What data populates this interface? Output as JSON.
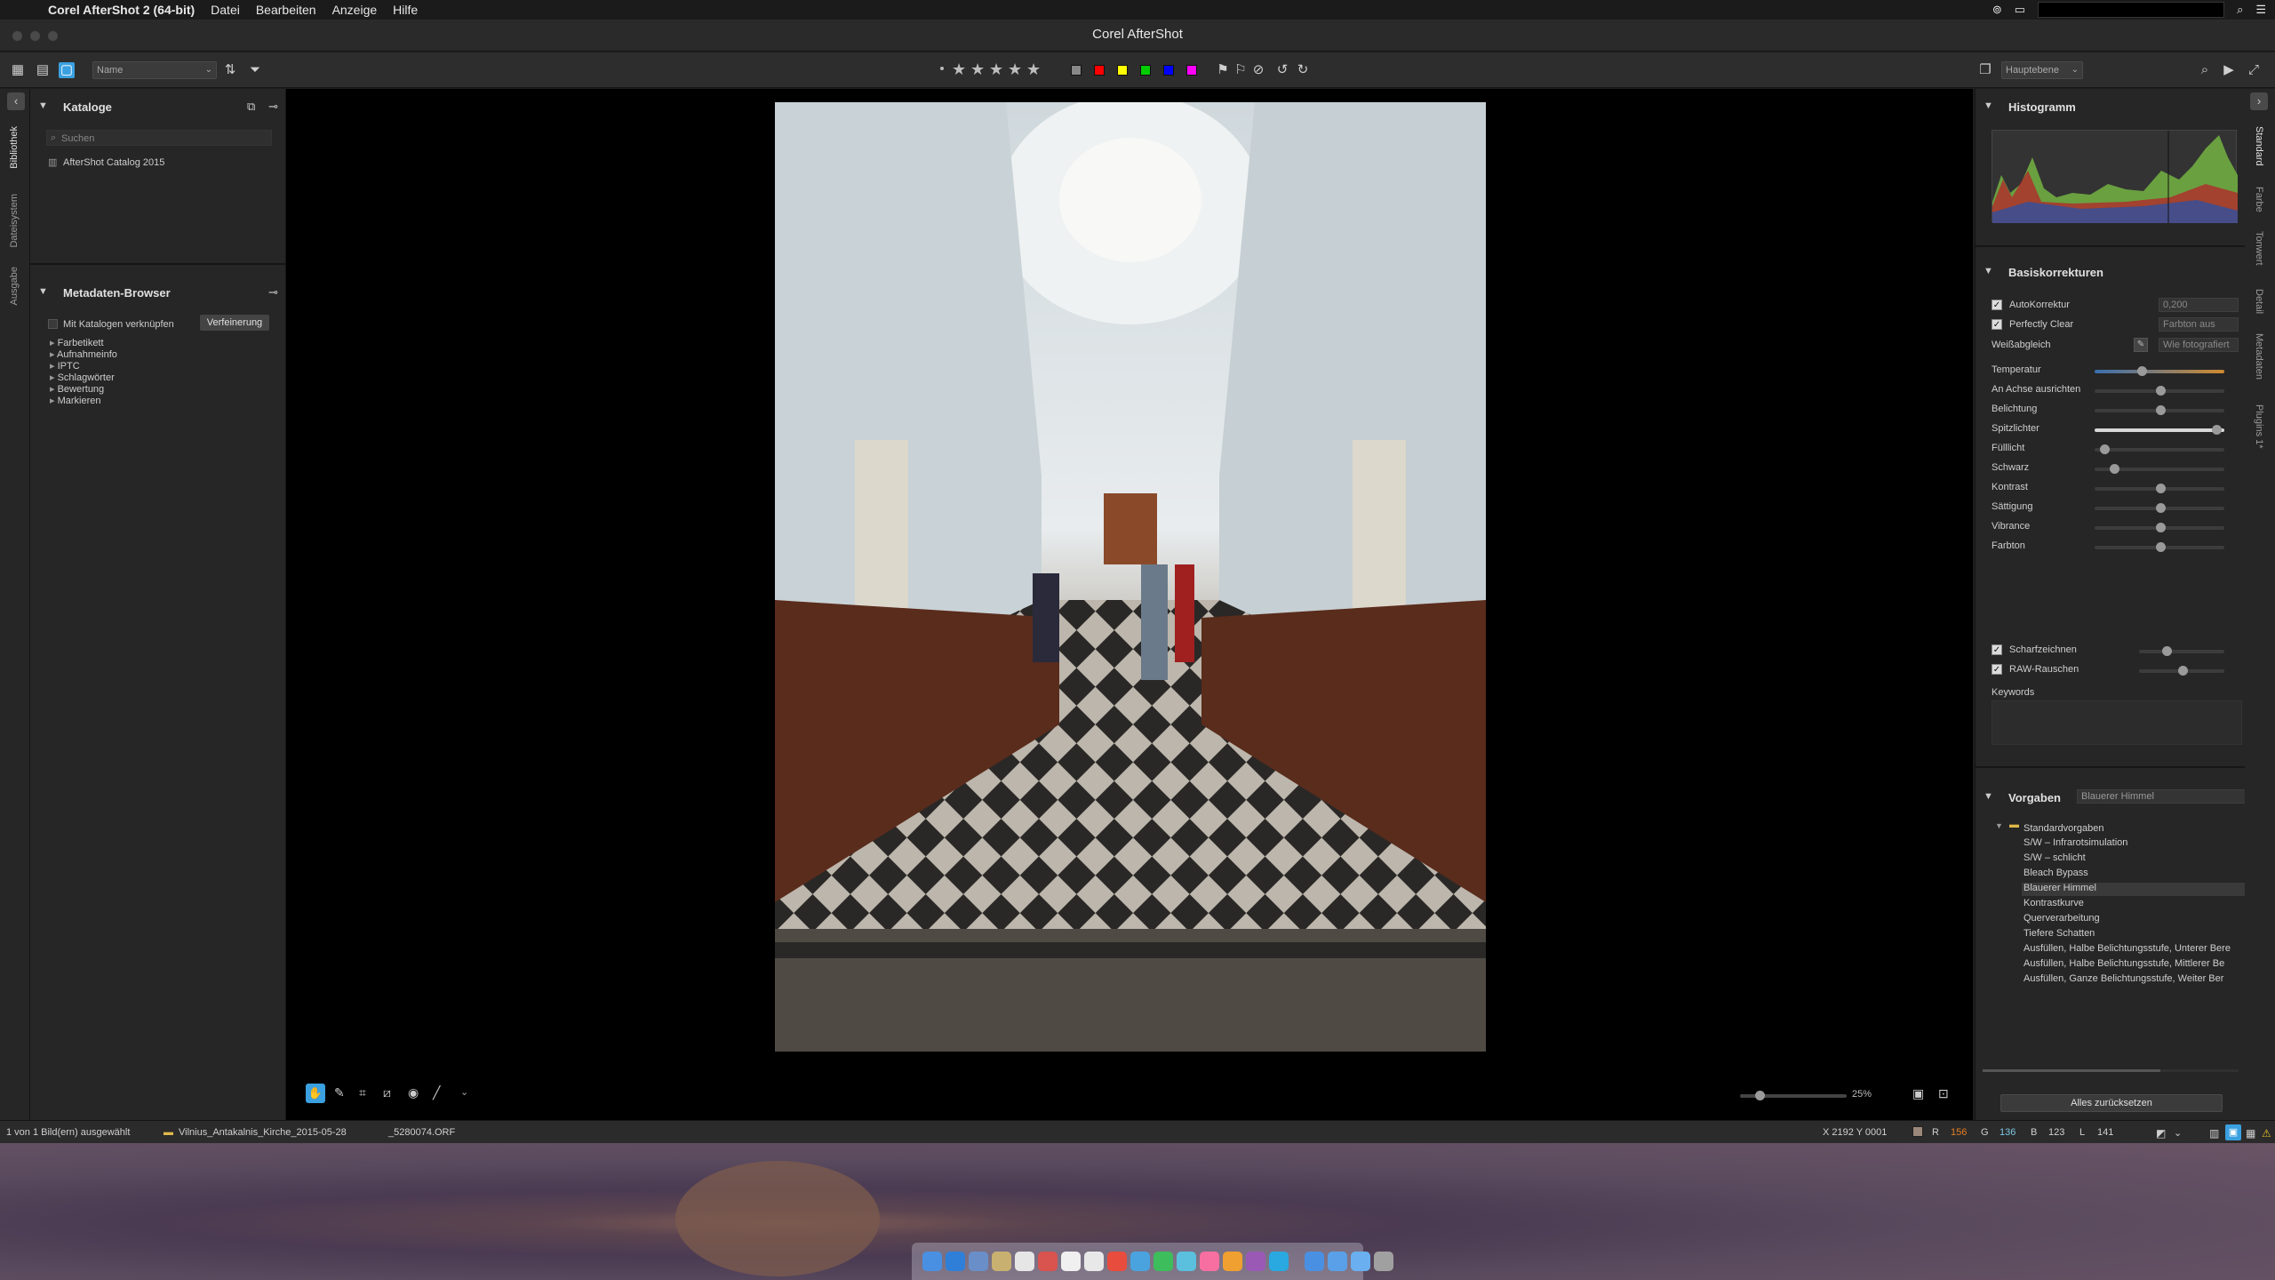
{
  "menubar": {
    "app": "Corel AfterShot 2 (64-bit)",
    "items": [
      "Datei",
      "Bearbeiten",
      "Anzeige",
      "Hilfe"
    ]
  },
  "window": {
    "title": "Corel AfterShot"
  },
  "toolbar": {
    "sort_field": "Name",
    "layer_select": "Hauptebene",
    "color_labels": [
      "#888888",
      "#ff0000",
      "#ffff00",
      "#00cc00",
      "#0000ff",
      "#ff00ff"
    ]
  },
  "left_tabs": [
    "Bibliothek",
    "Dateisystem",
    "Ausgabe"
  ],
  "catalogs": {
    "title": "Kataloge",
    "search_placeholder": "Suchen",
    "items": [
      "AfterShot Catalog 2015"
    ]
  },
  "metadata_browser": {
    "title": "Metadaten-Browser",
    "link_label": "Mit Katalogen verknüpfen",
    "refine_button": "Verfeinerung",
    "items": [
      "Farbetikett",
      "Aufnahmeinfo",
      "IPTC",
      "Schlagwörter",
      "Bewertung",
      "Markieren"
    ]
  },
  "right_tabs": [
    "Standard",
    "Farbe",
    "Tonwert",
    "Detail",
    "Metadaten",
    "Plugins 1*"
  ],
  "histogram": {
    "title": "Histogramm"
  },
  "basic": {
    "title": "Basiskorrekturen",
    "autocorrect": {
      "label": "AutoKorrektur",
      "value": "0,200"
    },
    "perfectly_clear": {
      "label": "Perfectly Clear",
      "value": "Farbton aus"
    },
    "white_balance": {
      "label": "Weißabgleich",
      "value": "Wie fotografiert"
    },
    "sliders": [
      {
        "label": "Temperatur",
        "value": 0.35
      },
      {
        "label": "An Achse ausrichten",
        "value": 0.5
      },
      {
        "label": "Belichtung",
        "value": 0.5
      },
      {
        "label": "Spitzlichter",
        "value": 0.96
      },
      {
        "label": "Fülllicht",
        "value": 0.04
      },
      {
        "label": "Schwarz",
        "value": 0.12
      },
      {
        "label": "Kontrast",
        "value": 0.5
      },
      {
        "label": "Sättigung",
        "value": 0.5
      },
      {
        "label": "Vibrance",
        "value": 0.5
      },
      {
        "label": "Farbton",
        "value": 0.5
      }
    ],
    "sharpen": {
      "label": "Scharfzeichnen",
      "value": 0.3
    },
    "raw_noise": {
      "label": "RAW-Rauschen",
      "value": 0.5
    },
    "keywords_label": "Keywords"
  },
  "presets": {
    "title": "Vorgaben",
    "current": "Blauerer Himmel",
    "folder": "Standardvorgaben",
    "items": [
      "S/W – Infrarotsimulation",
      "S/W – schlicht",
      "Bleach Bypass",
      "Blauerer Himmel",
      "Kontrastkurve",
      "Querverarbeitung",
      "Tiefere Schatten",
      "Ausfüllen, Halbe Belichtungsstufe, Unterer Bere",
      "Ausfüllen, Halbe Belichtungsstufe, Mittlerer Be",
      "Ausfüllen, Ganze Belichtungsstufe, Weiter Ber"
    ],
    "selected": "Blauerer Himmel",
    "reset_button": "Alles zurücksetzen"
  },
  "zoom": {
    "label": "25%",
    "value": 0.15
  },
  "status": {
    "selection": "1 von 1 Bild(ern) ausgewählt",
    "folder": "Vilnius_Antakalnis_Kirche_2015-05-28",
    "file": "_5280074.ORF",
    "coords": "X 2192  Y 0001",
    "r_label": "R",
    "r": "156",
    "g_label": "G",
    "g": "136",
    "b_label": "B",
    "b": "123",
    "l_label": "L",
    "l": "141",
    "pixel_color": "#9c887b"
  }
}
